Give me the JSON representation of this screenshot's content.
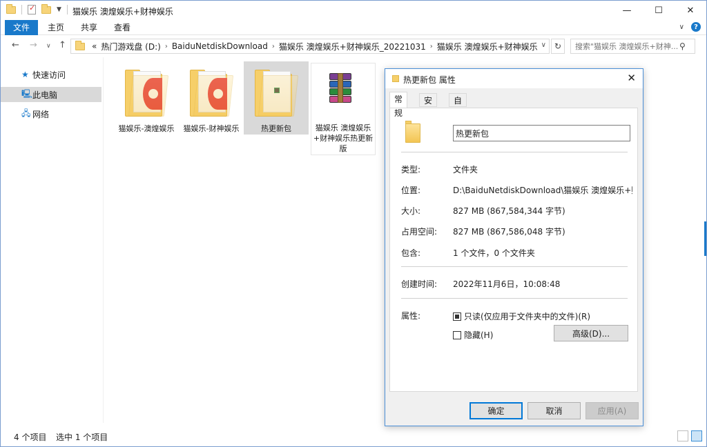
{
  "window": {
    "title": "猫娱乐 澳煌娱乐+财神娱乐",
    "controls": {
      "minimize": "—",
      "maximize": "☐",
      "close": "✕"
    }
  },
  "ribbon": {
    "tabs": [
      "文件",
      "主页",
      "共享",
      "查看"
    ],
    "collapse": "∨",
    "help": "?"
  },
  "nav": {
    "back": "←",
    "forward": "→",
    "recent": "∨",
    "up": "↑"
  },
  "address": {
    "overflow": "«",
    "crumbs": [
      "热门游戏盘 (D:)",
      "BaiduNetdiskDownload",
      "猫娱乐 澳煌娱乐+财神娱乐_20221031",
      "猫娱乐 澳煌娱乐+财神娱乐"
    ],
    "separator": "›",
    "dropdown": "∨",
    "refresh": "↻"
  },
  "search": {
    "placeholder": "搜索\"猫娱乐 澳煌娱乐+财神...",
    "icon": "search-icon"
  },
  "sidebar": {
    "items": [
      {
        "label": "快速访问",
        "icon": "star-icon",
        "selected": false
      },
      {
        "label": "此电脑",
        "icon": "computer-icon",
        "selected": true
      },
      {
        "label": "网络",
        "icon": "network-icon",
        "selected": false
      }
    ]
  },
  "files": [
    {
      "name": "猫娱乐-澳煌娱乐",
      "type": "folder",
      "selected": false
    },
    {
      "name": "猫娱乐-财神娱乐",
      "type": "folder",
      "selected": false
    },
    {
      "name": "热更新包",
      "type": "folder",
      "selected": true
    },
    {
      "name": "猫娱乐 澳煌娱乐+财神娱乐热更新版",
      "type": "rar-archive",
      "selected": false
    }
  ],
  "status": {
    "count": "4 个项目",
    "selection": "选中 1 个项目"
  },
  "dialog": {
    "title": "热更新包 属性",
    "close": "✕",
    "tabs": [
      "常规",
      "安全",
      "自定义"
    ],
    "name_value": "热更新包",
    "rows": [
      {
        "label": "类型:",
        "value": "文件夹"
      },
      {
        "label": "位置:",
        "value": "D:\\BaiduNetdiskDownload\\猫娱乐 澳煌娱乐+财神娱"
      },
      {
        "label": "大小:",
        "value": "827 MB (867,584,344 字节)"
      },
      {
        "label": "占用空间:",
        "value": "827 MB (867,586,048 字节)"
      },
      {
        "label": "包含:",
        "value": "1 个文件，0 个文件夹"
      }
    ],
    "created_label": "创建时间:",
    "created_value": "2022年11月6日，10:08:48",
    "attributes_label": "属性:",
    "readonly_label": "只读(仅应用于文件夹中的文件)(R)",
    "hidden_label": "隐藏(H)",
    "advanced_label": "高级(D)...",
    "ok_label": "确定",
    "cancel_label": "取消",
    "apply_label": "应用(A)"
  }
}
